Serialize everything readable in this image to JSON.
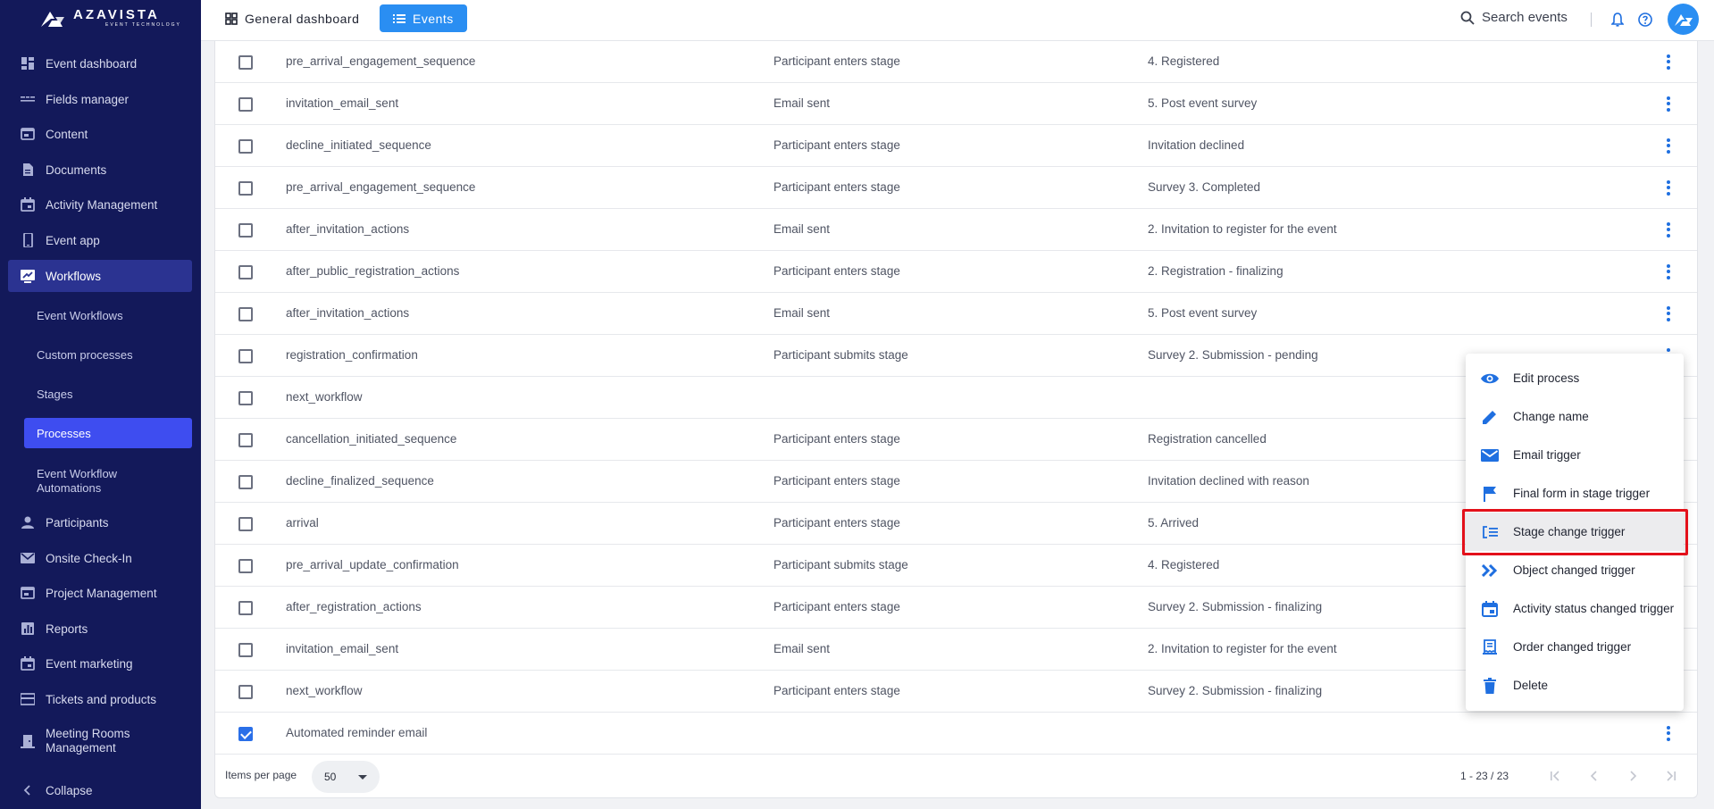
{
  "app": {
    "logo_name": "AZAVISTA",
    "logo_sub": "EVENT TECHNOLOGY"
  },
  "topbar": {
    "general_dashboard": "General dashboard",
    "events": "Events",
    "search_placeholder": "Search events"
  },
  "sidebar": {
    "items": [
      {
        "label": "Event dashboard",
        "icon": "dashboard-icon"
      },
      {
        "label": "Fields manager",
        "icon": "fields-icon"
      },
      {
        "label": "Content",
        "icon": "content-icon"
      },
      {
        "label": "Documents",
        "icon": "document-icon"
      },
      {
        "label": "Activity Management",
        "icon": "calendar-icon"
      },
      {
        "label": "Event app",
        "icon": "phone-icon"
      },
      {
        "label": "Workflows",
        "icon": "workflow-icon"
      },
      {
        "label": "Participants",
        "icon": "person-icon"
      },
      {
        "label": "Onsite Check-In",
        "icon": "mail-icon"
      },
      {
        "label": "Project Management",
        "icon": "project-icon"
      },
      {
        "label": "Reports",
        "icon": "reports-icon"
      },
      {
        "label": "Event marketing",
        "icon": "calendar-icon"
      },
      {
        "label": "Tickets and products",
        "icon": "ticket-icon"
      },
      {
        "label": "Meeting Rooms Management",
        "icon": "door-icon"
      }
    ],
    "sub_items": [
      {
        "label": "Event Workflows"
      },
      {
        "label": "Custom processes"
      },
      {
        "label": "Stages"
      },
      {
        "label": "Processes"
      },
      {
        "label": "Event Workflow Automations"
      }
    ],
    "collapse": "Collapse"
  },
  "table": {
    "rows": [
      {
        "name": "pre_arrival_engagement_sequence",
        "trigger": "Participant enters stage",
        "stage": "4. Registered",
        "checked": false
      },
      {
        "name": "invitation_email_sent",
        "trigger": "Email sent",
        "stage": "5. Post event survey",
        "checked": false
      },
      {
        "name": "decline_initiated_sequence",
        "trigger": "Participant enters stage",
        "stage": "Invitation declined",
        "checked": false
      },
      {
        "name": "pre_arrival_engagement_sequence",
        "trigger": "Participant enters stage",
        "stage": "Survey 3. Completed",
        "checked": false
      },
      {
        "name": "after_invitation_actions",
        "trigger": "Email sent",
        "stage": "2. Invitation to register for the event",
        "checked": false
      },
      {
        "name": "after_public_registration_actions",
        "trigger": "Participant enters stage",
        "stage": "2. Registration - finalizing",
        "checked": false
      },
      {
        "name": "after_invitation_actions",
        "trigger": "Email sent",
        "stage": "5. Post event survey",
        "checked": false
      },
      {
        "name": "registration_confirmation",
        "trigger": "Participant submits stage",
        "stage": "Survey 2. Submission - pending",
        "checked": false
      },
      {
        "name": "next_workflow",
        "trigger": "",
        "stage": "",
        "checked": false
      },
      {
        "name": "cancellation_initiated_sequence",
        "trigger": "Participant enters stage",
        "stage": "Registration cancelled",
        "checked": false
      },
      {
        "name": "decline_finalized_sequence",
        "trigger": "Participant enters stage",
        "stage": "Invitation declined with reason",
        "checked": false
      },
      {
        "name": "arrival",
        "trigger": "Participant enters stage",
        "stage": "5. Arrived",
        "checked": false
      },
      {
        "name": "pre_arrival_update_confirmation",
        "trigger": "Participant submits stage",
        "stage": "4. Registered",
        "checked": false
      },
      {
        "name": "after_registration_actions",
        "trigger": "Participant enters stage",
        "stage": "Survey 2. Submission - finalizing",
        "checked": false
      },
      {
        "name": "invitation_email_sent",
        "trigger": "Email sent",
        "stage": "2. Invitation to register for the event",
        "checked": false
      },
      {
        "name": "next_workflow",
        "trigger": "Participant enters stage",
        "stage": "Survey 2. Submission - finalizing",
        "checked": false
      },
      {
        "name": "Automated reminder email",
        "trigger": "",
        "stage": "",
        "checked": true
      }
    ]
  },
  "footer": {
    "items_per_page_label": "Items per page",
    "items_per_page_value": "50",
    "range": "1 - 23 / 23"
  },
  "menu": {
    "items": [
      {
        "label": "Edit process",
        "icon": "eye-icon"
      },
      {
        "label": "Change name",
        "icon": "pencil-icon"
      },
      {
        "label": "Email trigger",
        "icon": "envelope-icon"
      },
      {
        "label": "Final form in stage trigger",
        "icon": "flag-icon"
      },
      {
        "label": "Stage change trigger",
        "icon": "stage-change-icon"
      },
      {
        "label": "Object changed trigger",
        "icon": "double-chevron-icon"
      },
      {
        "label": "Activity status changed trigger",
        "icon": "calendar-icon"
      },
      {
        "label": "Order changed trigger",
        "icon": "receipt-icon"
      },
      {
        "label": "Delete",
        "icon": "trash-icon"
      }
    ],
    "highlighted": "Stage change trigger"
  },
  "colors": {
    "sidebar_bg": "#13195a",
    "active_nav": "#2b3391",
    "selected_sub": "#3e4df0",
    "accent_blue": "#2a8ef2",
    "highlight_red": "#e3101a"
  }
}
